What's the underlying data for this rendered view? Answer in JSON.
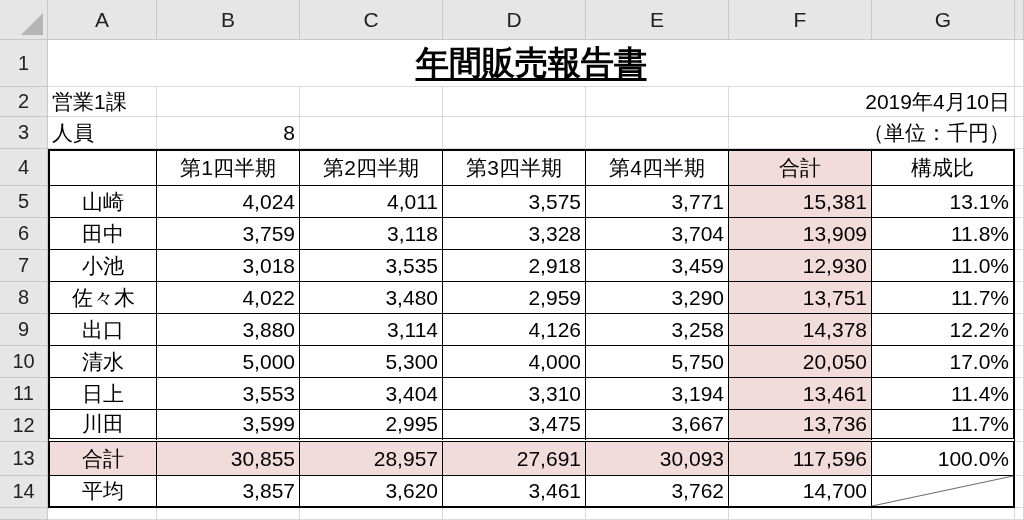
{
  "column_headers": [
    "A",
    "B",
    "C",
    "D",
    "E",
    "F",
    "G"
  ],
  "row_headers": [
    "1",
    "2",
    "3",
    "4",
    "5",
    "6",
    "7",
    "8",
    "9",
    "10",
    "11",
    "12",
    "13",
    "14"
  ],
  "title": "年間販売報告書",
  "department": "営業1課",
  "date": "2019年4月10日",
  "staff_label": "人員",
  "staff_count": "8",
  "unit": "（単位：千円）",
  "columns": [
    {
      "label": "第1四半期",
      "highlighted": false
    },
    {
      "label": "第2四半期",
      "highlighted": false
    },
    {
      "label": "第3四半期",
      "highlighted": false
    },
    {
      "label": "第4四半期",
      "highlighted": false
    },
    {
      "label": "合計",
      "highlighted": true
    },
    {
      "label": "構成比",
      "highlighted": false
    }
  ],
  "rows": [
    {
      "kind": "person",
      "name": "山崎",
      "values": [
        "4,024",
        "4,011",
        "3,575",
        "3,771"
      ],
      "total": "15,381",
      "share": "13.1%",
      "highlighted": false
    },
    {
      "kind": "person",
      "name": "田中",
      "values": [
        "3,759",
        "3,118",
        "3,328",
        "3,704"
      ],
      "total": "13,909",
      "share": "11.8%",
      "highlighted": false
    },
    {
      "kind": "person",
      "name": "小池",
      "values": [
        "3,018",
        "3,535",
        "2,918",
        "3,459"
      ],
      "total": "12,930",
      "share": "11.0%",
      "highlighted": false
    },
    {
      "kind": "person",
      "name": "佐々木",
      "values": [
        "4,022",
        "3,480",
        "2,959",
        "3,290"
      ],
      "total": "13,751",
      "share": "11.7%",
      "highlighted": false
    },
    {
      "kind": "person",
      "name": "出口",
      "values": [
        "3,880",
        "3,114",
        "4,126",
        "3,258"
      ],
      "total": "14,378",
      "share": "12.2%",
      "highlighted": false
    },
    {
      "kind": "person",
      "name": "清水",
      "values": [
        "5,000",
        "5,300",
        "4,000",
        "5,750"
      ],
      "total": "20,050",
      "share": "17.0%",
      "highlighted": false
    },
    {
      "kind": "person",
      "name": "日上",
      "values": [
        "3,553",
        "3,404",
        "3,310",
        "3,194"
      ],
      "total": "13,461",
      "share": "11.4%",
      "highlighted": false
    },
    {
      "kind": "person",
      "name": "川田",
      "values": [
        "3,599",
        "2,995",
        "3,475",
        "3,667"
      ],
      "total": "13,736",
      "share": "11.7%",
      "highlighted": false
    },
    {
      "kind": "total",
      "name": "合計",
      "values": [
        "30,855",
        "28,957",
        "27,691",
        "30,093"
      ],
      "total": "117,596",
      "share": "100.0%",
      "highlighted": true
    },
    {
      "kind": "average",
      "name": "平均",
      "values": [
        "3,857",
        "3,620",
        "3,461",
        "3,762"
      ],
      "total": "14,700",
      "share_crossed": true,
      "highlighted": false
    }
  ]
}
